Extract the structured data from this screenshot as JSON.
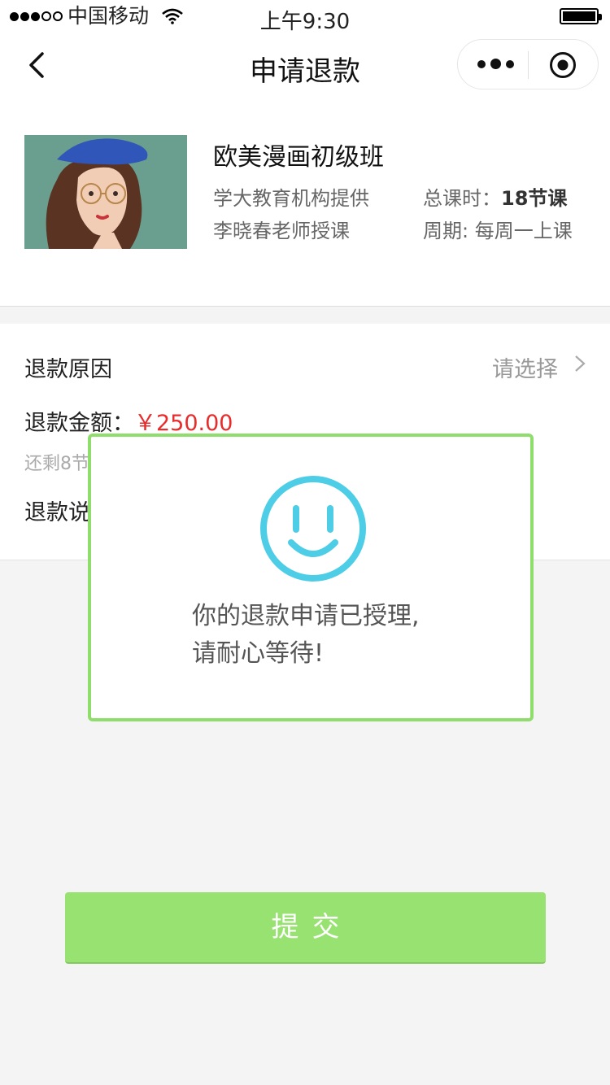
{
  "status_bar": {
    "carrier": "中国移动",
    "time": "上午9:30"
  },
  "nav": {
    "title": "申请退款"
  },
  "course": {
    "title": "欧美漫画初级班",
    "provider": "学大教育机构提供",
    "teacher": "李晓春老师授课",
    "total_label": "总课时：",
    "total_value": "18节课",
    "period": "周期: 每周一上课"
  },
  "form": {
    "reason_label": "退款原因",
    "reason_placeholder": "请选择",
    "amount_label": "退款金额：",
    "amount_value": "￥250.00",
    "remain_visible": "还剩8节",
    "desc_label_visible": "退款说"
  },
  "modal": {
    "line1": "你的退款申请已授理,",
    "line2": "请耐心等待!"
  },
  "submit": {
    "label": "提交"
  },
  "colors": {
    "accent_green": "#98e271",
    "modal_border": "#8fdd6d",
    "smile_blue": "#4dcde6",
    "price_red": "#e92b2b"
  }
}
